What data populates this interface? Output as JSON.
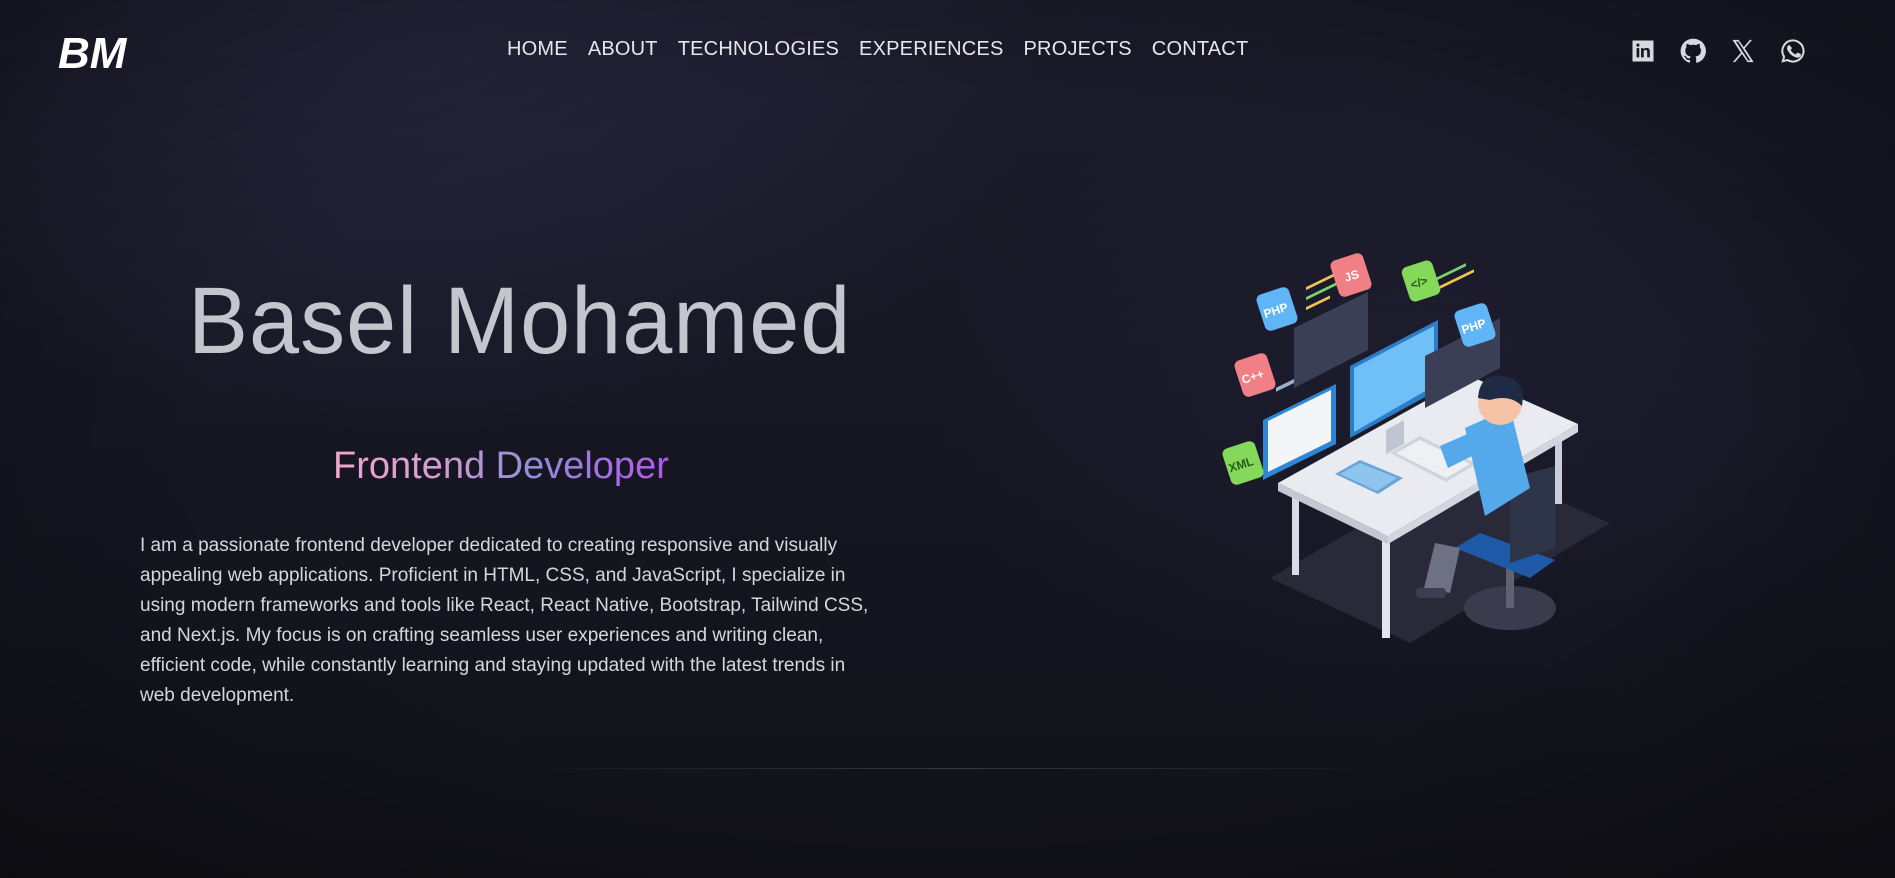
{
  "header": {
    "logo_text": "BM",
    "nav": [
      {
        "label": "HOME"
      },
      {
        "label": "ABOUT"
      },
      {
        "label": "TECHNOLOGIES"
      },
      {
        "label": "EXPERIENCES"
      },
      {
        "label": "PROJECTS"
      },
      {
        "label": "CONTACT"
      }
    ],
    "social": [
      {
        "icon": "linkedin-icon"
      },
      {
        "icon": "github-icon"
      },
      {
        "icon": "x-icon"
      },
      {
        "icon": "whatsapp-icon"
      }
    ]
  },
  "hero": {
    "name": "Basel Mohamed",
    "role": "Frontend Developer",
    "description": "I am a passionate frontend developer dedicated to creating responsive and visually appealing web applications. Proficient in HTML, CSS, and JavaScript, I specialize in using modern frameworks and tools like React, React Native, Bootstrap, Tailwind CSS, and Next.js. My focus is on crafting seamless user experiences and writing clean, efficient code, while constantly learning and staying updated with the latest trends in web development.",
    "illustration": {
      "badges": [
        "PHP",
        "JS",
        "</>",
        "PHP",
        "C++",
        "XML"
      ]
    }
  },
  "colors": {
    "background": "#161622",
    "text": "#e6e6ee",
    "gradient_start": "#f3a5c9",
    "gradient_end": "#b456ee"
  }
}
